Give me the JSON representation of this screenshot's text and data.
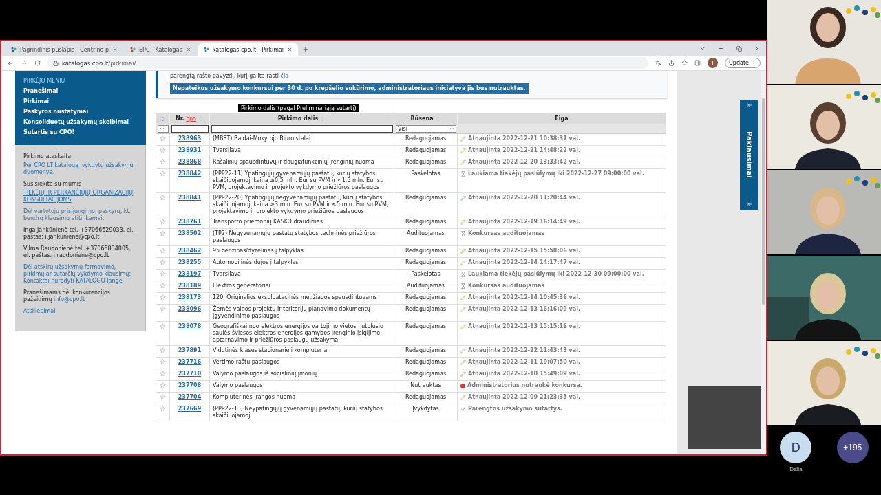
{
  "browser": {
    "tabs": [
      {
        "title": "Pagrindinis puslapis - Centrinė p",
        "selected": false
      },
      {
        "title": "EPC - Katalogas",
        "selected": false
      },
      {
        "title": "katalogas.cpo.lt - Pirkimai",
        "selected": true
      }
    ],
    "url_host": "katalogas.cpo.lt",
    "url_path": "/pirkimai/",
    "profile": "I",
    "update_button": "Update"
  },
  "sidebar": {
    "menu_title": "PIRKĖJO MENIU",
    "menu_items": [
      "Pranešimai",
      "Pirkimai",
      "Paskyros nustatymai",
      "Konsoliduotų užsakymų skelbimai",
      "Sutartis su CPO!"
    ],
    "info": [
      [
        {
          "kind": "label",
          "text": "Pirkimų ataskaita"
        },
        {
          "kind": "link",
          "text": "Per CPO LT katalogą įvykdytų užsakymų duomenys."
        }
      ],
      [
        {
          "kind": "label",
          "text": "Susisiekite su mumis"
        },
        {
          "kind": "caps-link",
          "text": "TIEKĖJŲ IR PERKANČIŲJŲ ORGANIZACIJŲ KONSULTACIJOMS"
        }
      ],
      [
        {
          "kind": "link",
          "text": "Dėl vartotojų prisijungimo, paskyrų, kt. bendrų klausimų atitinkamai:"
        }
      ],
      [
        {
          "kind": "label",
          "text": "Inga Jankūnienė tel. +37066629033, el. paštas: i.jankuniene@cpo.lt"
        }
      ],
      [
        {
          "kind": "label",
          "text": "Vilma Raudonienė tel. +37065834005, el. paštas: i.raudoniene@cpo.lt"
        }
      ],
      [
        {
          "kind": "link",
          "text": "Dėl atskirų užsakymų formavimo, pirkimų ar sutarčių vykdymo klausimų: Kontaktai nurodyti KATALOGO lange"
        }
      ],
      [
        {
          "kind": "label",
          "text": "Pranešimams dėl konkurencijos pažeidimų",
          "link": "info@cpo.lt"
        }
      ],
      [
        {
          "kind": "link",
          "text": "Atsiliepimai"
        }
      ]
    ]
  },
  "notice": {
    "text": "parengtą rašto pavyzdį, kurį galite rasti",
    "link": "čia",
    "alert": "Nepateikus užsakymo konkursui per 30 d. po krepšelio sukūrimo, administratoriaus iniciatyva jis bus nutrauktas."
  },
  "table": {
    "tooltip": "Pirkimo dalis (pagal Preliminariąją sutartį)",
    "columns": [
      {
        "label": "Nr.",
        "tag": "cpo",
        "sortable": true
      },
      {
        "label": "Pirkimo dalis",
        "sortable": true
      },
      {
        "label": "Būsena",
        "sortable": true
      },
      {
        "label": "Eiga",
        "sortable": false
      }
    ],
    "status_filter": "Visi",
    "rows": [
      {
        "nr": "238963",
        "title": "(MBST) Baldai-Mokytojo Biuro stalai",
        "status": "Redaguojamas",
        "progress": {
          "kind": "updated",
          "text": "Atnaujinta 2022-12-21 10:38:31 val."
        }
      },
      {
        "nr": "238931",
        "title": "Tvarsliava",
        "status": "Redaguojamas",
        "progress": {
          "kind": "updated",
          "text": "Atnaujinta 2022-12-21 14:48:22 val."
        }
      },
      {
        "nr": "238868",
        "title": "Rašalinių spausdintuvų ir daugiafunkcinių įrenginių nuoma",
        "status": "Redaguojamas",
        "progress": {
          "kind": "updated",
          "text": "Atnaujinta 2022-12-20 13:33:42 val."
        }
      },
      {
        "nr": "238842",
        "title": "(PPP22-11) Ypatingųjų gyvenamųjų pastatų, kurių statybos skaičiuojamoji kaina ≥0,5 mln. Eur su PVM ir <1,5 mln. Eur su PVM, projektavimo ir projekto vykdymo priežiūros paslaugos",
        "status": "Paskelbtas",
        "progress": {
          "kind": "waiting",
          "text": "Laukiama tiekėjų pasiūlymų iki 2022-12-27 09:00:00 val."
        }
      },
      {
        "nr": "238841",
        "title": "(PPP22-20) Ypatingųjų negyvenamųjų pastatų, kurių statybos skaičiuojamoji kaina ≥3 mln. Eur su PVM ir <5 mln. Eur su PVM, projektavimo ir projekto vykdymo priežiūros paslaugos",
        "status": "Redaguojamas",
        "progress": {
          "kind": "updated",
          "text": "Atnaujinta 2022-12-20 11:20:44 val."
        }
      },
      {
        "nr": "238761",
        "title": "Transporto priemonių KASKO draudimas",
        "status": "Redaguojamas",
        "progress": {
          "kind": "updated",
          "text": "Atnaujinta 2022-12-19 16:14:49 val."
        }
      },
      {
        "nr": "238502",
        "title": "(TP2) Negyvenamųjų pastatų statybos techninės priežiūros paslaugos",
        "status": "Audituojamas",
        "progress": {
          "kind": "audit",
          "text": "Konkursas audituojamas"
        }
      },
      {
        "nr": "238462",
        "title": "95 benzinas/dyzelinas į talpyklas",
        "status": "Redaguojamas",
        "progress": {
          "kind": "updated",
          "text": "Atnaujinta 2022-12-15 15:58:06 val."
        }
      },
      {
        "nr": "238255",
        "title": "Automobilinės dujos į talpyklas",
        "status": "Redaguojamas",
        "progress": {
          "kind": "updated",
          "text": "Atnaujinta 2022-12-14 14:17:47 val."
        }
      },
      {
        "nr": "238197",
        "title": "Tvarsliava",
        "status": "Paskelbtas",
        "progress": {
          "kind": "waiting",
          "text": "Laukiama tiekėjų pasiūlymų iki 2022-12-30 09:00:00 val."
        }
      },
      {
        "nr": "238189",
        "title": "Elektros generatoriai",
        "status": "Audituojamas",
        "progress": {
          "kind": "audit",
          "text": "Konkursas audituojamas"
        }
      },
      {
        "nr": "238173",
        "title": "120. Originalios eksploatacinės medžiagos spausdintuvams",
        "status": "Redaguojamas",
        "progress": {
          "kind": "updated",
          "text": "Atnaujinta 2022-12-14 10:45:36 val."
        }
      },
      {
        "nr": "238096",
        "title": "Žemės valdos projektų ir teritorijų planavimo dokumentų įgyvendinimo paslaugos",
        "status": "Redaguojamas",
        "progress": {
          "kind": "updated",
          "text": "Atnaujinta 2022-12-13 16:16:09 val."
        }
      },
      {
        "nr": "238078",
        "title": "Geografiškai nuo elektros energijos vartojimo vietos nutolusio saulės šviesos elektros energijos gamybos įrenginio įsigijimo, aptarnavimo ir priežiūros paslaugų užsakymai",
        "status": "Redaguojamas",
        "progress": {
          "kind": "updated",
          "text": "Atnaujinta 2022-12-13 15:15:16 val."
        }
      },
      {
        "nr": "237891",
        "title": "Vidutinės klasės stacionarieji kompiuteriai",
        "status": "Redaguojamas",
        "progress": {
          "kind": "updated",
          "text": "Atnaujinta 2022-12-22 11:43:43 val."
        }
      },
      {
        "nr": "237716",
        "title": "Vertimo raštu paslaugos",
        "status": "Redaguojamas",
        "progress": {
          "kind": "updated",
          "text": "Atnaujinta 2022-12-11 19:07:50 val."
        }
      },
      {
        "nr": "237710",
        "title": "Valymo paslaugos iš socialinių įmonių",
        "status": "Redaguojamas",
        "progress": {
          "kind": "updated",
          "text": "Atnaujinta 2022-12-10 15:49:09 val."
        }
      },
      {
        "nr": "237708",
        "title": "Valymo paslaugos",
        "status": "Nutrauktas",
        "progress": {
          "kind": "cancelled",
          "text": "Administratorius nutraukė konkursą."
        }
      },
      {
        "nr": "237704",
        "title": "Kompiuterinės įrangos nuoma",
        "status": "Redaguojamas",
        "progress": {
          "kind": "updated",
          "text": "Atnaujinta 2022-12-09 21:23:35 val."
        }
      },
      {
        "nr": "237669",
        "title": "(PPP22-13) Neypatingųjų gyvenamųjų pastatų, kurių statybos skaičiuojamoji",
        "status": "Įvykdytas",
        "progress": {
          "kind": "done",
          "text": "Parengtos užsakymo sutartys."
        }
      }
    ]
  },
  "side_tab": "Paklausimai",
  "participants": {
    "avatar_letter": "D",
    "name": "Dalia",
    "more": "+195"
  }
}
